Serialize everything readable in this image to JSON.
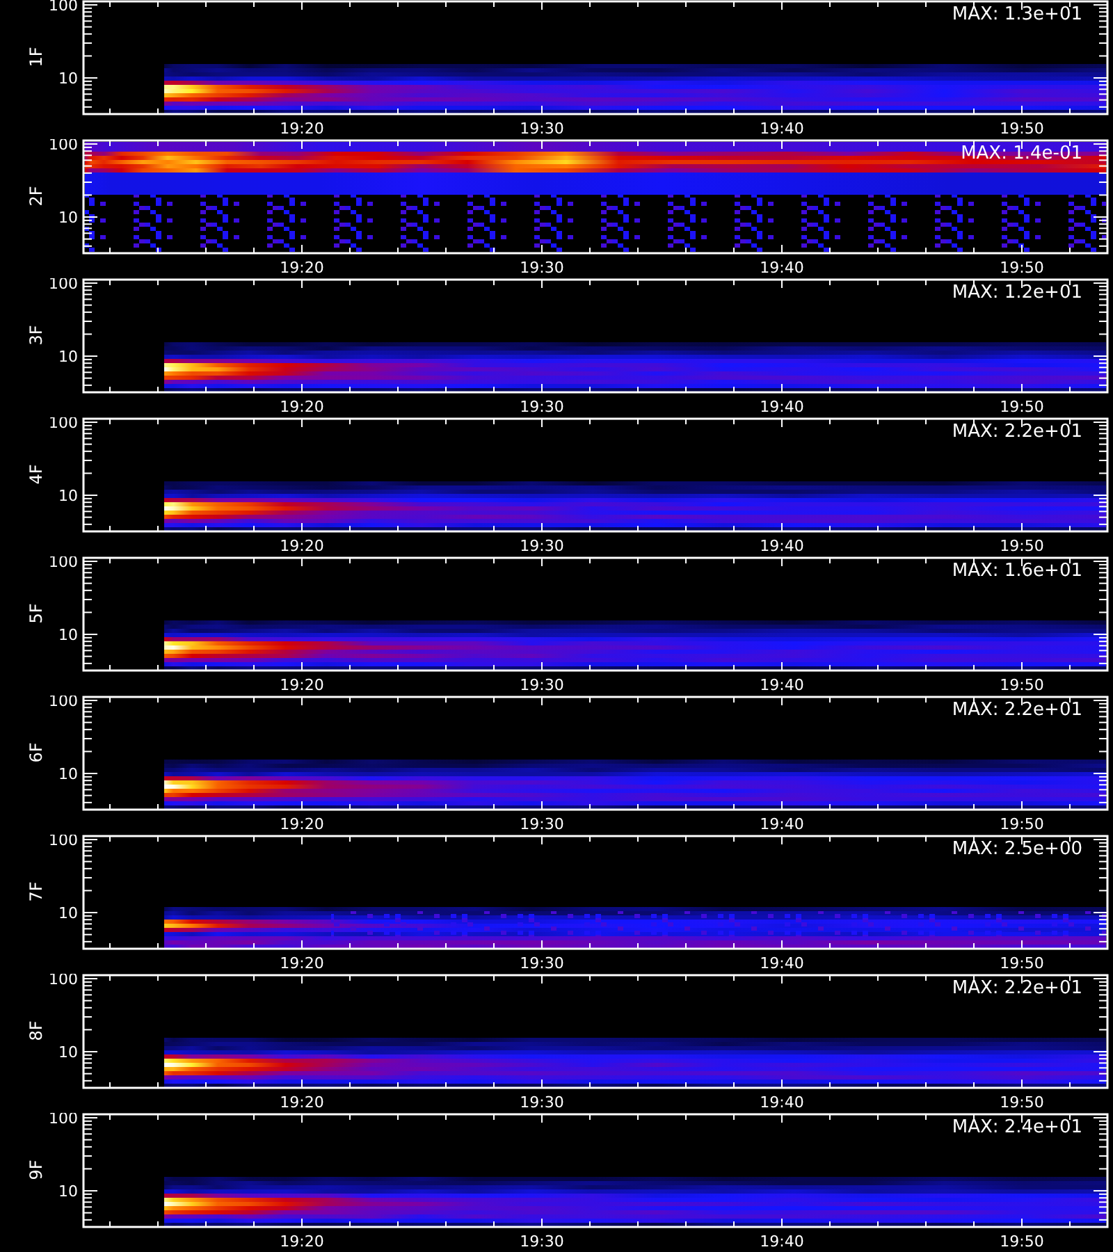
{
  "panels": [
    {
      "label": "1F",
      "max_label": "MAX: 1.3e+01",
      "kind": "decay",
      "y_tick_labels": [
        "100",
        "10"
      ],
      "x_tick_labels": [
        "19:20",
        "19:30",
        "19:40",
        "19:50"
      ]
    },
    {
      "label": "2F",
      "max_label": "MAX: 1.4e-01",
      "kind": "high-band",
      "y_tick_labels": [
        "100",
        "10"
      ],
      "x_tick_labels": [
        "19:20",
        "19:30",
        "19:40",
        "19:50"
      ]
    },
    {
      "label": "3F",
      "max_label": "MAX: 1.2e+01",
      "kind": "decay",
      "y_tick_labels": [
        "100",
        "10"
      ],
      "x_tick_labels": [
        "19:20",
        "19:30",
        "19:40",
        "19:50"
      ]
    },
    {
      "label": "4F",
      "max_label": "MAX: 2.2e+01",
      "kind": "decay",
      "y_tick_labels": [
        "100",
        "10"
      ],
      "x_tick_labels": [
        "19:20",
        "19:30",
        "19:40",
        "19:50"
      ]
    },
    {
      "label": "5F",
      "max_label": "MAX: 1.6e+01",
      "kind": "decay",
      "y_tick_labels": [
        "100",
        "10"
      ],
      "x_tick_labels": [
        "19:20",
        "19:30",
        "19:40",
        "19:50"
      ]
    },
    {
      "label": "6F",
      "max_label": "MAX: 2.2e+01",
      "kind": "decay",
      "y_tick_labels": [
        "100",
        "10"
      ],
      "x_tick_labels": [
        "19:20",
        "19:30",
        "19:40",
        "19:50"
      ]
    },
    {
      "label": "7F",
      "max_label": "MAX: 2.5e+00",
      "kind": "noisy-decay",
      "y_tick_labels": [
        "100",
        "10"
      ],
      "x_tick_labels": [
        "19:20",
        "19:30",
        "19:40",
        "19:50"
      ]
    },
    {
      "label": "8F",
      "max_label": "MAX: 2.2e+01",
      "kind": "decay",
      "y_tick_labels": [
        "100",
        "10"
      ],
      "x_tick_labels": [
        "19:20",
        "19:30",
        "19:40",
        "19:50"
      ]
    },
    {
      "label": "9F",
      "max_label": "MAX: 2.4e+01",
      "kind": "decay",
      "y_tick_labels": [
        "100",
        "10"
      ],
      "x_tick_labels": [
        "19:20",
        "19:30",
        "19:40",
        "19:50"
      ]
    }
  ]
}
